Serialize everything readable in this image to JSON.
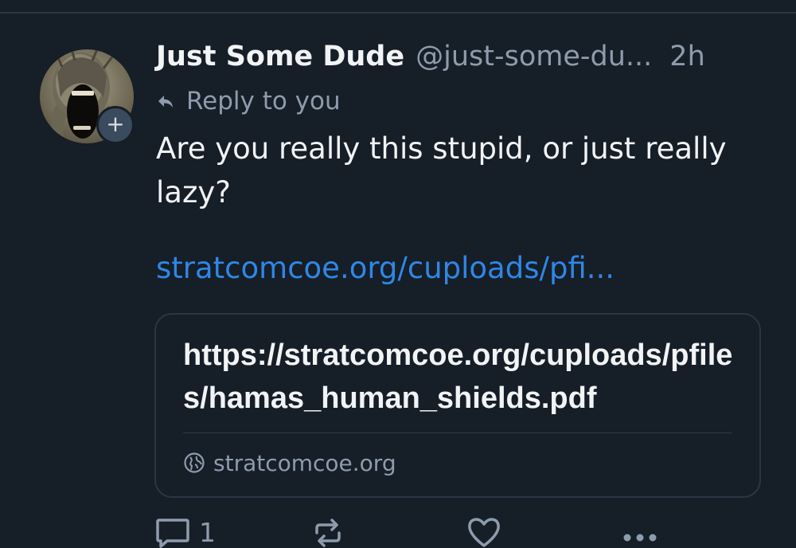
{
  "post": {
    "author": {
      "display_name": "Just Some Dude",
      "handle": "@just-some-du...",
      "avatar_icon": "screaming-face-avatar",
      "follow_icon": "plus-icon",
      "follow_symbol": "+"
    },
    "timestamp": "2h",
    "reply_context": {
      "icon": "reply-arrow-icon",
      "text": "Reply to you"
    },
    "text": "Are you really this stupid, or just really lazy?",
    "link": "stratcomcoe.org/cuploads/pfi...",
    "link_card": {
      "title": "https://stratcomcoe.org/cuploads/pfiles/hamas_human_shields.pdf",
      "domain": "stratcomcoe.org",
      "domain_icon": "globe-icon"
    },
    "actions": {
      "reply": {
        "icon": "speech-bubble-icon",
        "count": "1"
      },
      "repost": {
        "icon": "repost-arrows-icon"
      },
      "like": {
        "icon": "heart-icon"
      },
      "more": {
        "icon": "more-dots-icon"
      }
    }
  },
  "colors": {
    "background": "#161e27",
    "text_primary": "#f1f3f5",
    "text_secondary": "#8d9cad",
    "link": "#2f87e6",
    "border": "#2a3644"
  }
}
